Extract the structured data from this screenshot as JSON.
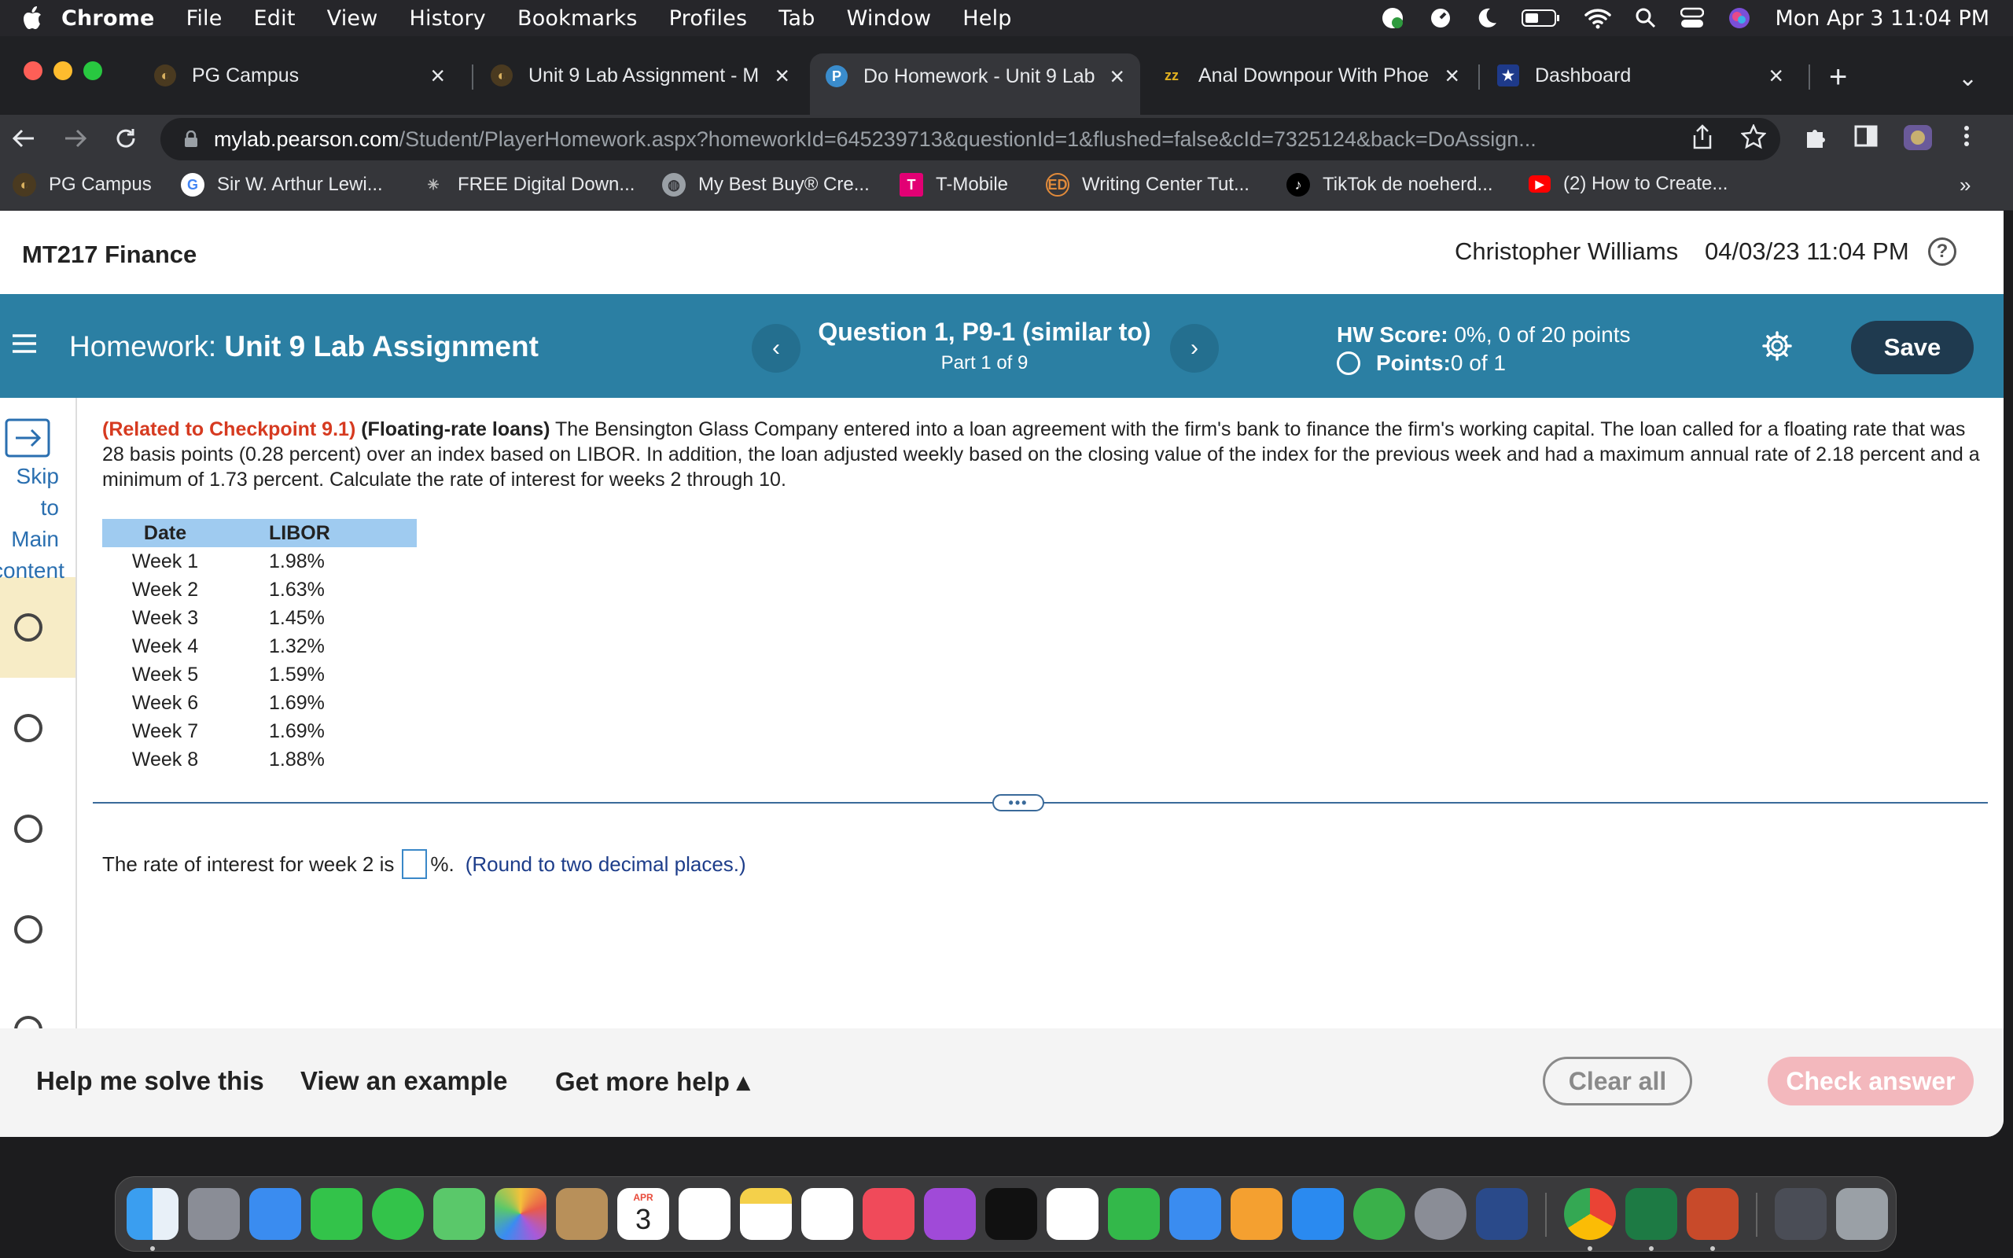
{
  "menubar": {
    "app": "Chrome",
    "items": [
      "File",
      "Edit",
      "View",
      "History",
      "Bookmarks",
      "Profiles",
      "Tab",
      "Window",
      "Help"
    ],
    "clock": "Mon Apr 3  11:04 PM"
  },
  "tabs": [
    {
      "title": "PG Campus"
    },
    {
      "title": "Unit 9 Lab Assignment - M"
    },
    {
      "title": "Do Homework - Unit 9 Lab"
    },
    {
      "title": "Anal Downpour With Phoe"
    },
    {
      "title": "Dashboard"
    }
  ],
  "address": {
    "domain": "mylab.pearson.com",
    "path": "/Student/PlayerHomework.aspx?homeworkId=645239713&questionId=1&flushed=false&cId=7325124&back=DoAssign..."
  },
  "bookmarks": [
    "PG Campus",
    "Sir W. Arthur Lewi...",
    "FREE Digital Down...",
    "My Best Buy® Cre...",
    "T-Mobile",
    "Writing Center Tut...",
    "TikTok de noeherd...",
    "(2) How to Create..."
  ],
  "bookmarks_more": "»",
  "page": {
    "course": "MT217 Finance",
    "user": "Christopher Williams",
    "datetime": "04/03/23 11:04 PM",
    "help_symbol": "?"
  },
  "hw": {
    "label": "Homework:",
    "name": "Unit 9 Lab Assignment",
    "question_title": "Question 1, P9-1 (similar to)",
    "question_part": "Part 1 of 9",
    "score_label": "HW Score:",
    "score_value": " 0%, 0 of 20 points",
    "points_label": "Points:",
    "points_value": " 0 of 1",
    "save_label": "Save"
  },
  "sidebar": {
    "skip_text": "Skip to Main content"
  },
  "problem": {
    "ref": "(Related to Checkpoint 9.1)",
    "topic": "(Floating-rate loans)",
    "body": "The Bensington Glass Company entered into a loan agreement with the firm's bank to finance the firm's working capital.  The loan called for a floating rate that was 28 basis points (0.28 percent) over an index based on LIBOR.  In addition, the loan adjusted weekly based on the closing value of the index for the previous week and had a maximum annual rate of 2.18 percent and a minimum of 1.73 percent.  Calculate the rate of interest for weeks 2 through 10."
  },
  "table": {
    "headers": [
      "Date",
      "LIBOR"
    ],
    "rows": [
      [
        "Week 1",
        "1.98%"
      ],
      [
        "Week 2",
        "1.63%"
      ],
      [
        "Week 3",
        "1.45%"
      ],
      [
        "Week 4",
        "1.32%"
      ],
      [
        "Week 5",
        "1.59%"
      ],
      [
        "Week 6",
        "1.69%"
      ],
      [
        "Week 7",
        "1.69%"
      ],
      [
        "Week 8",
        "1.88%"
      ]
    ]
  },
  "answer": {
    "prefix": "The rate of interest for week 2 is",
    "suffix": "%.",
    "hint": "(Round to two decimal places.)"
  },
  "footer": {
    "help_solve": "Help me solve this",
    "view_example": "View an example",
    "more_help": "Get more help ▴",
    "clear_all": "Clear all",
    "check_answer": "Check answer"
  },
  "dock_calendar": {
    "month": "APR",
    "day": "3"
  }
}
